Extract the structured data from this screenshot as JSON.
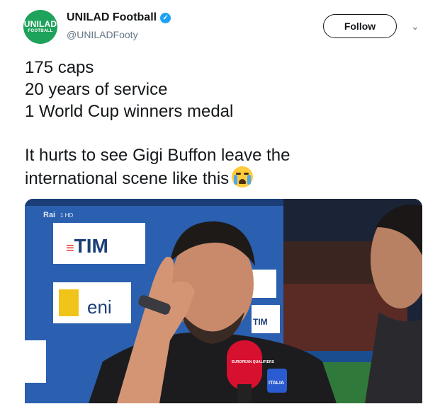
{
  "account": {
    "avatar_line1": "UNILAD",
    "avatar_line2": "FOOTBALL",
    "name": "UNILAD Football",
    "handle": "@UNILADFooty",
    "verified_icon": "verified-badge-icon"
  },
  "actions": {
    "follow_label": "Follow",
    "menu_icon": "chevron-down-icon"
  },
  "tweet": {
    "lines": [
      "175 caps",
      "20 years of service",
      "1 World Cup winners medal",
      "It hurts to see Gigi Buffon leave the",
      "international scene like this"
    ],
    "emoji": "crying-face-emoji"
  },
  "media": {
    "broadcaster": "Rai",
    "broadcaster_channel": "1 HD",
    "sponsor_tim": "TIM",
    "sponsor_eni": "eni",
    "mic_label": "EUROPEAN QUALIFIERS",
    "shirt_label": "ITALIA"
  },
  "colors": {
    "brand_green": "#1fa25b",
    "verified_blue": "#1da1f2"
  }
}
